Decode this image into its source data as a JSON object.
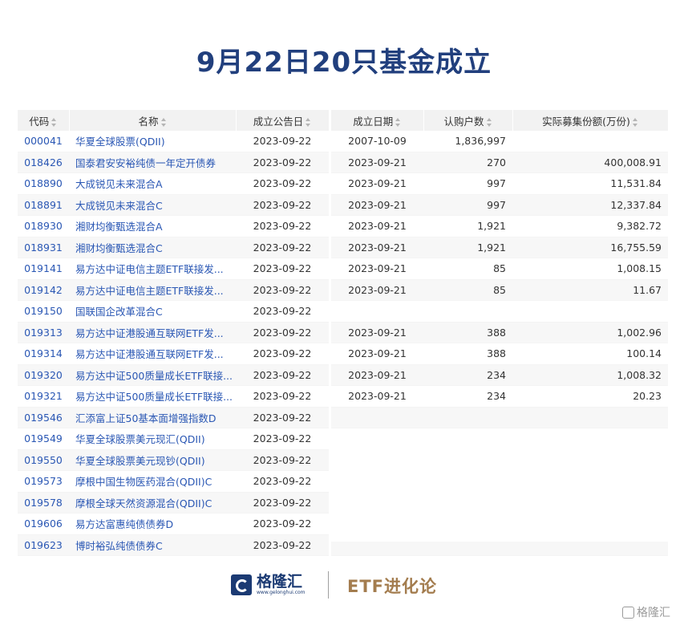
{
  "title": "9月22日20只基金成立",
  "left_table": {
    "headers": [
      "代码",
      "名称",
      "成立公告日"
    ],
    "rows": [
      [
        "000041",
        "华夏全球股票(QDII)",
        "2023-09-22"
      ],
      [
        "018426",
        "国泰君安安裕纯债一年定开债券",
        "2023-09-22"
      ],
      [
        "018890",
        "大成锐见未来混合A",
        "2023-09-22"
      ],
      [
        "018891",
        "大成锐见未来混合C",
        "2023-09-22"
      ],
      [
        "018930",
        "湘财均衡甄选混合A",
        "2023-09-22"
      ],
      [
        "018931",
        "湘财均衡甄选混合C",
        "2023-09-22"
      ],
      [
        "019141",
        "易方达中证电信主题ETF联接发...",
        "2023-09-22"
      ],
      [
        "019142",
        "易方达中证电信主题ETF联接发...",
        "2023-09-22"
      ],
      [
        "019150",
        "国联国企改革混合C",
        "2023-09-22"
      ],
      [
        "019313",
        "易方达中证港股通互联网ETF发...",
        "2023-09-22"
      ],
      [
        "019314",
        "易方达中证港股通互联网ETF发...",
        "2023-09-22"
      ],
      [
        "019320",
        "易方达中证500质量成长ETF联接...",
        "2023-09-22"
      ],
      [
        "019321",
        "易方达中证500质量成长ETF联接...",
        "2023-09-22"
      ],
      [
        "019546",
        "汇添富上证50基本面增强指数D",
        "2023-09-22"
      ],
      [
        "019549",
        "华夏全球股票美元现汇(QDII)",
        "2023-09-22"
      ],
      [
        "019550",
        "华夏全球股票美元现钞(QDII)",
        "2023-09-22"
      ],
      [
        "019573",
        "摩根中国生物医药混合(QDII)C",
        "2023-09-22"
      ],
      [
        "019578",
        "摩根全球天然资源混合(QDII)C",
        "2023-09-22"
      ],
      [
        "019606",
        "易方达富惠纯债债券D",
        "2023-09-22"
      ],
      [
        "019623",
        "博时裕弘纯债债券C",
        "2023-09-22"
      ]
    ]
  },
  "right_table": {
    "headers": [
      "成立日期",
      "认购户数",
      "实际募集份额(万份)"
    ],
    "rows": [
      [
        "2007-10-09",
        "1,836,997",
        ""
      ],
      [
        "2023-09-21",
        "270",
        "400,008.91"
      ],
      [
        "2023-09-21",
        "997",
        "11,531.84"
      ],
      [
        "2023-09-21",
        "997",
        "12,337.84"
      ],
      [
        "2023-09-21",
        "1,921",
        "9,382.72"
      ],
      [
        "2023-09-21",
        "1,921",
        "16,755.59"
      ],
      [
        "2023-09-21",
        "85",
        "1,008.15"
      ],
      [
        "2023-09-21",
        "85",
        "11.67"
      ],
      [
        "",
        "",
        ""
      ],
      [
        "2023-09-21",
        "388",
        "1,002.96"
      ],
      [
        "2023-09-21",
        "388",
        "100.14"
      ],
      [
        "2023-09-21",
        "234",
        "1,008.32"
      ],
      [
        "2023-09-21",
        "234",
        "20.23"
      ],
      [
        "",
        "",
        ""
      ],
      [
        "",
        "",
        ""
      ],
      [
        "",
        "",
        ""
      ],
      [
        "",
        "",
        ""
      ],
      [
        "",
        "",
        ""
      ],
      [
        "",
        "",
        ""
      ],
      [
        "",
        "",
        ""
      ]
    ]
  },
  "footer": {
    "logo_text": "格隆汇",
    "logo_url": "www.gelonghui.com",
    "brand": "ETF进化论"
  },
  "watermark": "格隆汇",
  "colors": {
    "title": "#213f7d",
    "link": "#2a57b4",
    "brand": "#a37c4e",
    "header_bg": "#f2f2f2"
  }
}
